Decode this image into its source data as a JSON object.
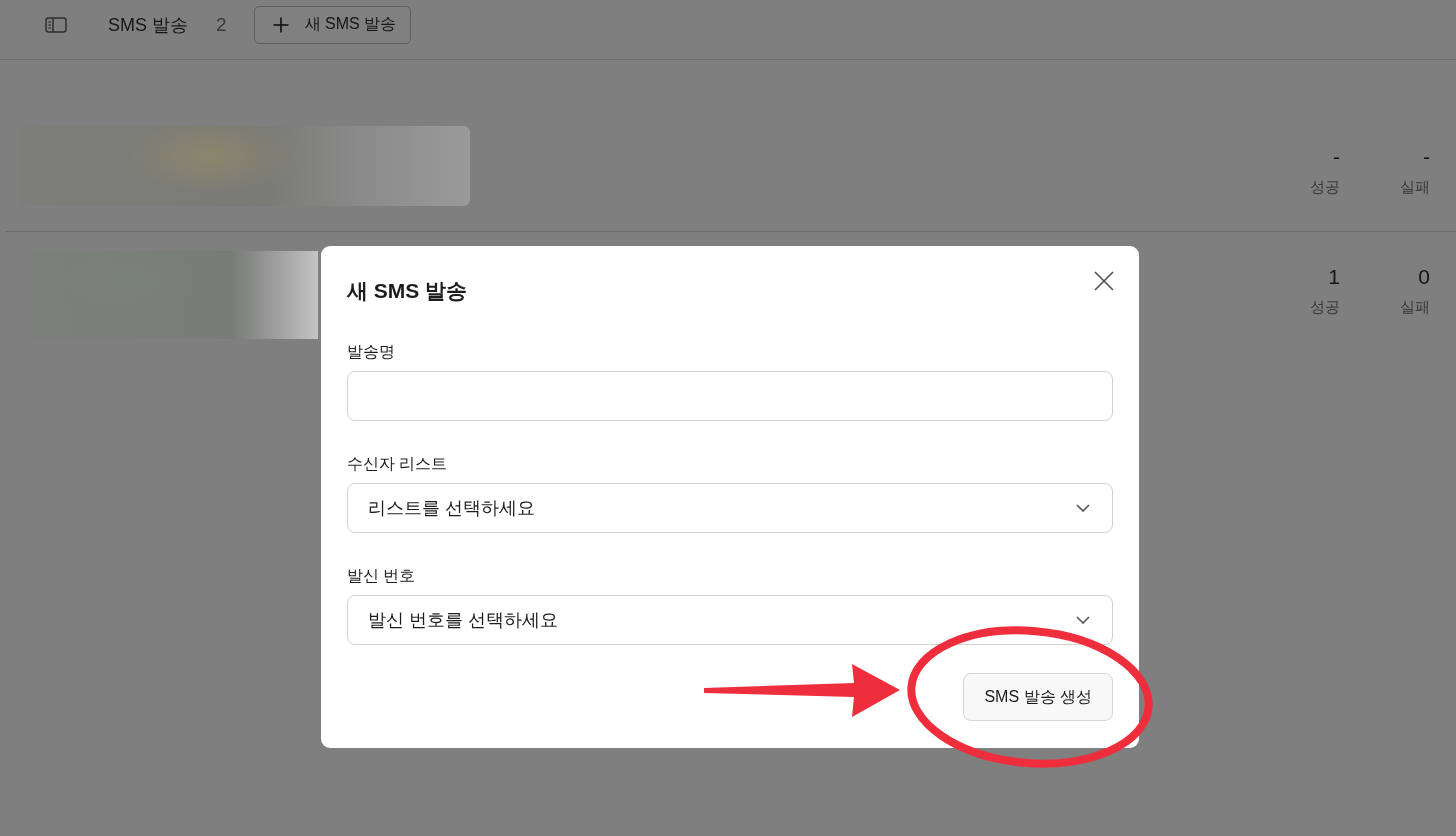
{
  "header": {
    "title": "SMS 발송",
    "count": "2",
    "new_button": "새 SMS 발송"
  },
  "campaigns": [
    {
      "stats": [
        {
          "value": "-",
          "label": "성공"
        },
        {
          "value": "-",
          "label": "실패"
        }
      ]
    },
    {
      "stats": [
        {
          "value": "1",
          "label": "성공"
        },
        {
          "value": "0",
          "label": "실패"
        }
      ]
    }
  ],
  "dialog": {
    "title": "새 SMS 발송",
    "fields": [
      {
        "kind": "text",
        "label": "발송명"
      },
      {
        "kind": "select",
        "label": "수신자 리스트",
        "placeholder": "리스트를 선택하세요"
      },
      {
        "kind": "select",
        "label": "발신 번호",
        "placeholder": "발신 번호를 선택하세요"
      }
    ],
    "submit_button": "SMS 발송 생성"
  }
}
